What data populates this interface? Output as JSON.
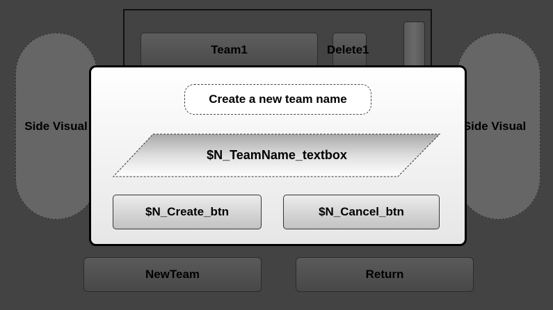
{
  "background": {
    "side_left_label": "Side Visual",
    "side_right_label": "Side Visual",
    "team_item_label": "Team1",
    "delete_label": "Delete1",
    "new_team_label": "NewTeam",
    "return_label": "Return"
  },
  "dialog": {
    "title": "Create a new team name",
    "textbox_label": "$N_TeamName_textbox",
    "create_label": "$N_Create_btn",
    "cancel_label": "$N_Cancel_btn"
  }
}
